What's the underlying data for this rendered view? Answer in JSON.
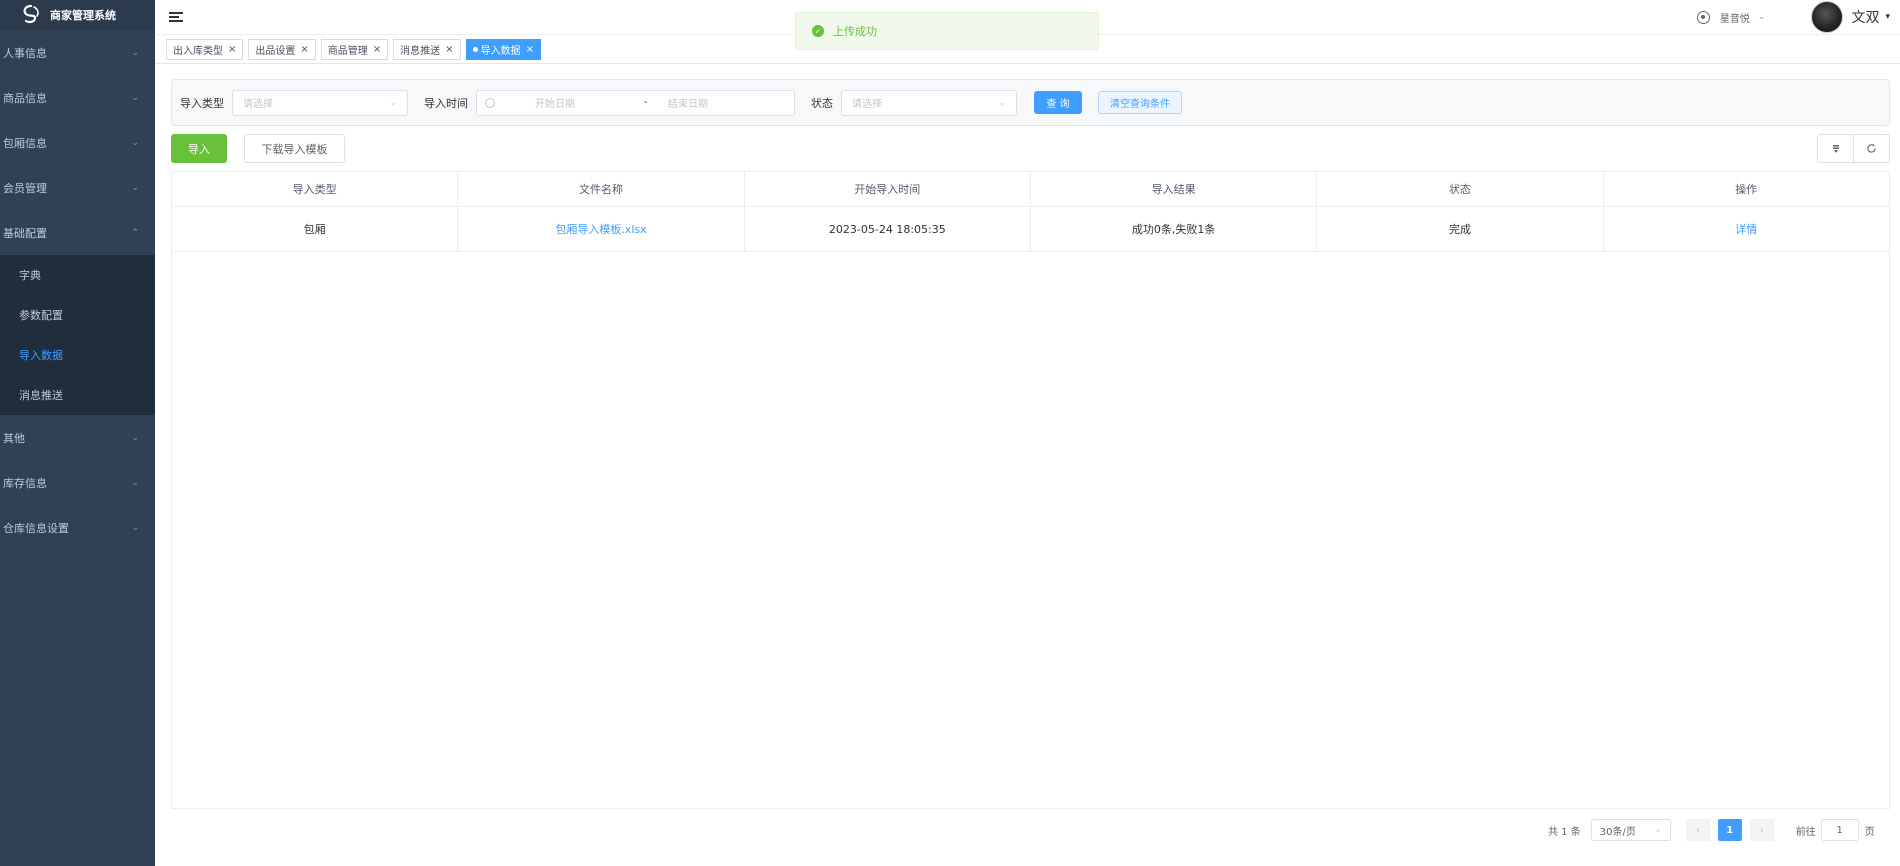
{
  "app": {
    "title": "商家管理系统"
  },
  "sidebar": {
    "items": [
      {
        "label": "人事信息"
      },
      {
        "label": "商品信息"
      },
      {
        "label": "包厢信息"
      },
      {
        "label": "会员管理"
      },
      {
        "label": "基础配置",
        "expanded": true,
        "children": [
          {
            "label": "字典"
          },
          {
            "label": "参数配置"
          },
          {
            "label": "导入数据",
            "active": true
          },
          {
            "label": "消息推送"
          }
        ]
      },
      {
        "label": "其他"
      },
      {
        "label": "库存信息"
      },
      {
        "label": "仓库信息设置"
      }
    ]
  },
  "header": {
    "store": "星音悦",
    "user": "文双"
  },
  "tags": [
    {
      "label": "出入库类型"
    },
    {
      "label": "出品设置"
    },
    {
      "label": "商品管理"
    },
    {
      "label": "消息推送"
    },
    {
      "label": "导入数据",
      "active": true
    }
  ],
  "toast": {
    "message": "上传成功",
    "type": "success"
  },
  "search": {
    "import_type_label": "导入类型",
    "import_type_placeholder": "请选择",
    "import_time_label": "导入时间",
    "start_placeholder": "开始日期",
    "range_separator": "-",
    "end_placeholder": "结束日期",
    "status_label": "状态",
    "status_placeholder": "请选择",
    "query_button": "查 询",
    "clear_button": "清空查询条件"
  },
  "toolbar": {
    "import_button": "导入",
    "download_template_button": "下载导入模板"
  },
  "table": {
    "columns": [
      "导入类型",
      "文件名称",
      "开始导入时间",
      "导入结果",
      "状态",
      "操作"
    ],
    "rows": [
      {
        "import_type": "包厢",
        "file_name": "包厢导入模板.xlsx",
        "start_time": "2023-05-24 18:05:35",
        "result": "成功0条,失败1条",
        "status": "完成",
        "action": "详情"
      }
    ]
  },
  "pagination": {
    "total_text": "共 1 条",
    "page_size": "30条/页",
    "current_page": "1",
    "goto_label": "前往",
    "goto_value": "1",
    "page_suffix": "页"
  },
  "colors": {
    "sidebar_bg": "#304156",
    "primary": "#409eff",
    "success": "#67c23a"
  }
}
